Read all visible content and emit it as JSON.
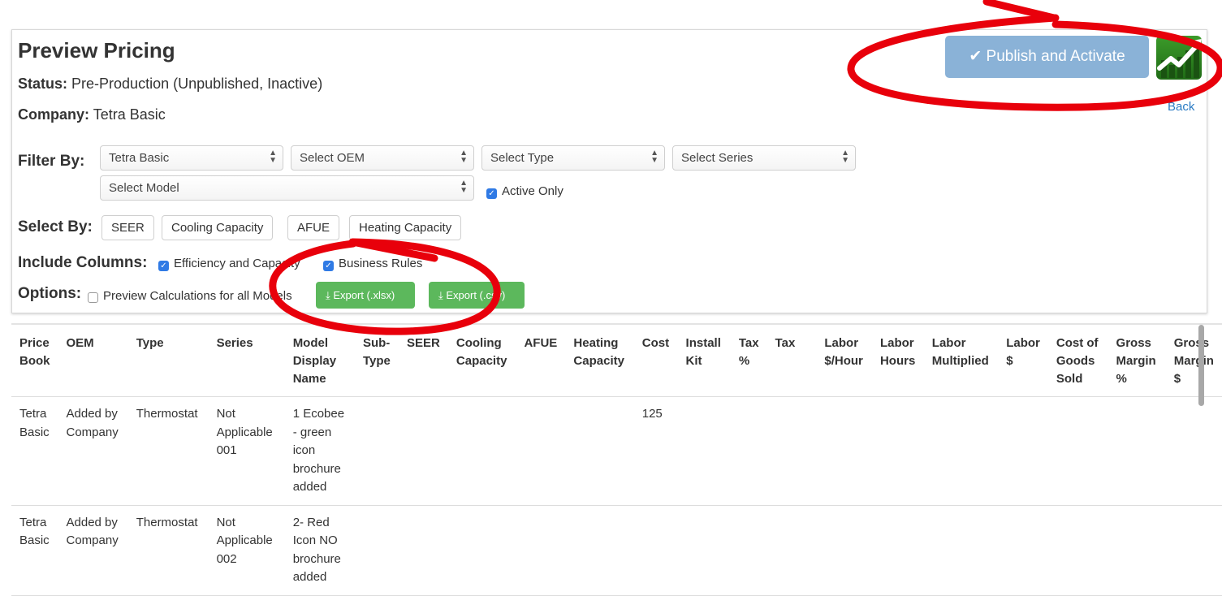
{
  "page": {
    "title": "Preview Pricing",
    "status_label": "Status:",
    "status_value": "Pre-Production (Unpublished, Inactive)",
    "company_label": "Company:",
    "company_value": "Tetra Basic",
    "back_link": "Back"
  },
  "actions": {
    "publish_label": "Publish and Activate",
    "check_glyph": "✔",
    "logo_icon": "trending-chart-icon"
  },
  "filter": {
    "label": "Filter By:",
    "price_book": "Tetra Basic",
    "oem": "Select OEM",
    "type": "Select Type",
    "series": "Select Series",
    "model": "Select Model",
    "active_only": "Active Only"
  },
  "select_by": {
    "label": "Select By:",
    "buttons": [
      "SEER",
      "Cooling Capacity",
      "AFUE",
      "Heating Capacity"
    ]
  },
  "include_columns": {
    "label": "Include Columns:",
    "efficiency": "Efficiency and Capacity",
    "business_rules": "Business Rules"
  },
  "options": {
    "label": "Options:",
    "preview_calc": "Preview Calculations for all Models",
    "export_xlsx": "Export (.xlsx)",
    "export_csv": "Export (.csv)"
  },
  "table": {
    "headers": [
      "Price Book",
      "OEM",
      "Type",
      "Series",
      "Model Display Name",
      "Sub-Type",
      "SEER",
      "Cooling Capacity",
      "AFUE",
      "Heating Capacity",
      "Cost",
      "Install Kit",
      "Tax %",
      "Tax",
      "Labor $/Hour",
      "Labor Hours",
      "Labor Multiplied",
      "Labor $",
      "Cost of Goods Sold",
      "Gross Margin %",
      "Gross Margin $"
    ],
    "rows": [
      [
        "Tetra Basic",
        "Added by Company",
        "Thermostat",
        "Not Applicable 001",
        "1 Ecobee - green icon brochure added",
        "",
        "",
        "",
        "",
        "",
        "125",
        "",
        "",
        "",
        "",
        "",
        "",
        "",
        "",
        "",
        ""
      ],
      [
        "Tetra Basic",
        "Added by Company",
        "Thermostat",
        "Not Applicable 002",
        "2- Red Icon NO brochure added",
        "",
        "",
        "",
        "",
        "",
        "",
        "",
        "",
        "",
        "",
        "",
        "",
        "",
        "",
        "",
        ""
      ]
    ]
  },
  "colors": {
    "publish_button": "#8ab2d7",
    "export_button": "#5cb85c",
    "link": "#2b7bc4",
    "annotation": "#e8000b"
  }
}
